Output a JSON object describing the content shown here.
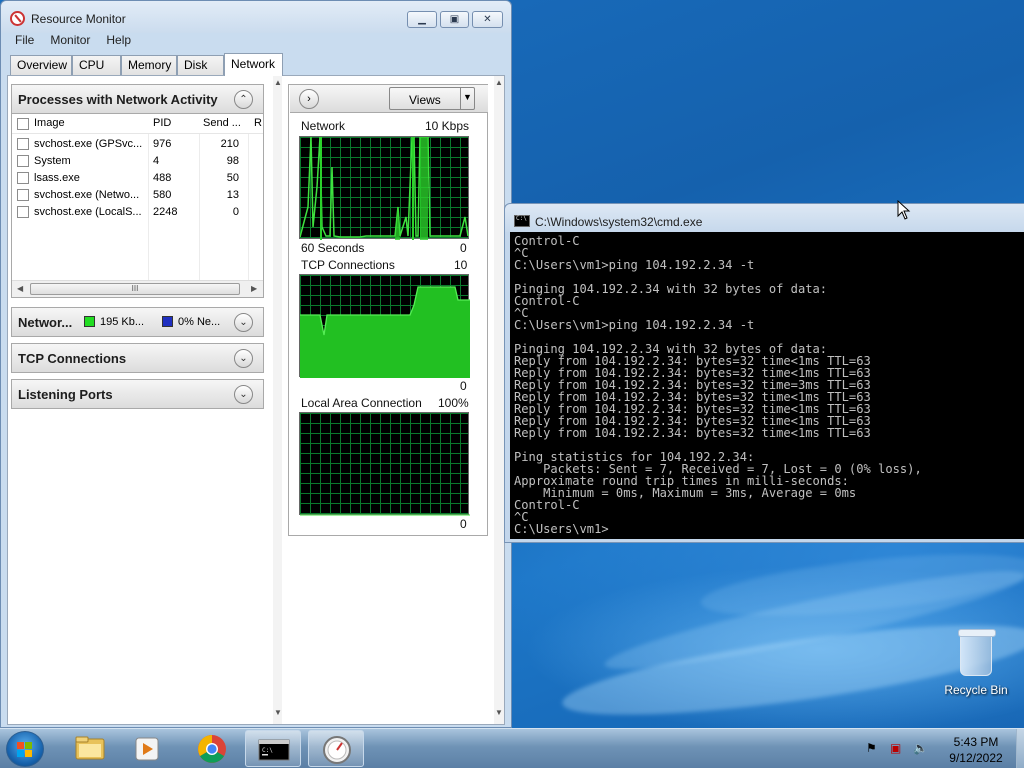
{
  "resmon": {
    "title": "Resource Monitor",
    "menu": [
      "File",
      "Monitor",
      "Help"
    ],
    "tabs": [
      "Overview",
      "CPU",
      "Memory",
      "Disk",
      "Network"
    ],
    "active_tab": "Network",
    "processes_section": {
      "title": "Processes with Network Activity",
      "columns": [
        "Image",
        "PID",
        "Send ...",
        "R"
      ],
      "rows": [
        {
          "image": "svchost.exe (GPSvc...",
          "pid": "976",
          "send": "210"
        },
        {
          "image": "System",
          "pid": "4",
          "send": "98"
        },
        {
          "image": "lsass.exe",
          "pid": "488",
          "send": "50"
        },
        {
          "image": "svchost.exe (Netwo...",
          "pid": "580",
          "send": "13"
        },
        {
          "image": "svchost.exe (LocalS...",
          "pid": "2248",
          "send": "0"
        }
      ],
      "scroll_grip": "III"
    },
    "network_section": {
      "title": "Networ...",
      "legend1": "195 Kb...",
      "legend1_color": "#22dd22",
      "legend2": "0% Ne...",
      "legend2_color": "#1f2fc0"
    },
    "tcp_section": {
      "title": "TCP Connections"
    },
    "listening_section": {
      "title": "Listening Ports"
    },
    "views_button": "Views",
    "graphs": [
      {
        "label": "Network",
        "max": "10 Kbps",
        "min": "0",
        "footer": "60 Seconds"
      },
      {
        "label": "TCP Connections",
        "max": "10",
        "min": "0"
      },
      {
        "label": "Local Area Connection",
        "max": "100%",
        "min": "0"
      }
    ]
  },
  "cmd": {
    "title": "C:\\Windows\\system32\\cmd.exe",
    "lines": [
      "Control-C",
      "^C",
      "C:\\Users\\vm1>ping 104.192.2.34 -t",
      "",
      "Pinging 104.192.2.34 with 32 bytes of data:",
      "Control-C",
      "^C",
      "C:\\Users\\vm1>ping 104.192.2.34 -t",
      "",
      "Pinging 104.192.2.34 with 32 bytes of data:",
      "Reply from 104.192.2.34: bytes=32 time<1ms TTL=63",
      "Reply from 104.192.2.34: bytes=32 time<1ms TTL=63",
      "Reply from 104.192.2.34: bytes=32 time=3ms TTL=63",
      "Reply from 104.192.2.34: bytes=32 time<1ms TTL=63",
      "Reply from 104.192.2.34: bytes=32 time<1ms TTL=63",
      "Reply from 104.192.2.34: bytes=32 time<1ms TTL=63",
      "Reply from 104.192.2.34: bytes=32 time<1ms TTL=63",
      "",
      "Ping statistics for 104.192.2.34:",
      "    Packets: Sent = 7, Received = 7, Lost = 0 (0% loss),",
      "Approximate round trip times in milli-seconds:",
      "    Minimum = 0ms, Maximum = 3ms, Average = 0ms",
      "Control-C",
      "^C",
      "C:\\Users\\vm1>"
    ]
  },
  "desktop": {
    "recycle_bin_label": "Recycle Bin"
  },
  "taskbar": {
    "time": "5:43 PM",
    "date": "9/12/2022"
  }
}
